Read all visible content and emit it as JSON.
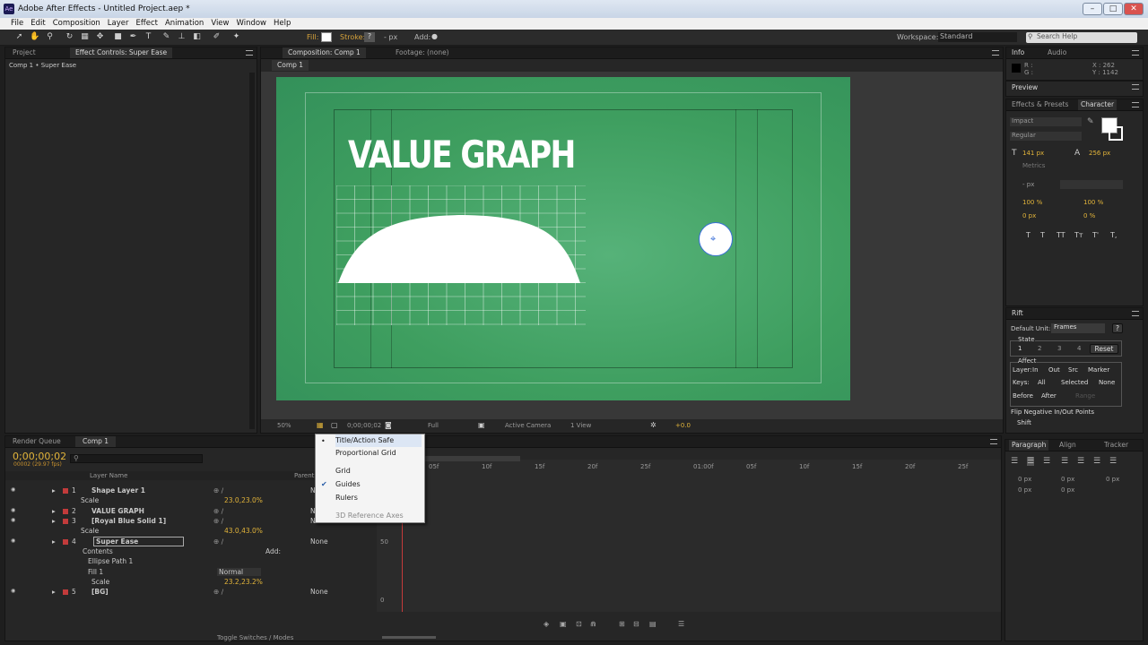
{
  "window": {
    "title": "Adobe After Effects - Untitled Project.aep *",
    "app_icon": "Ae",
    "min": "–",
    "max": "□",
    "close": "✕"
  },
  "menu": [
    "File",
    "Edit",
    "Composition",
    "Layer",
    "Effect",
    "Animation",
    "View",
    "Window",
    "Help"
  ],
  "toolbar": {
    "fill_label": "Fill:",
    "stroke_label": "Stroke:",
    "stroke_value": "?",
    "px_label": "- px",
    "add_label": "Add:",
    "workspace_label": "Workspace:",
    "workspace_value": "Standard",
    "search_placeholder": "Search Help"
  },
  "left_panel": {
    "tab_project": "Project",
    "tab_effect_controls": "Effect Controls: Super Ease",
    "subtitle": "Comp 1 • Super Ease"
  },
  "comp_panel": {
    "tab_comp": "Composition: Comp 1",
    "tab_footage": "Footage: (none)",
    "sub_tab": "Comp 1",
    "headline": "VALUE GRAPH"
  },
  "viewer_footer": {
    "zoom": "50%",
    "time": "0;00;00;02",
    "resolution": "Full",
    "camera": "Active Camera",
    "view": "1 View",
    "exposure": "+0.0"
  },
  "info_panel": {
    "tab_info": "Info",
    "tab_audio": "Audio",
    "r": "R :",
    "g": "G :",
    "x": "X : 262",
    "y": "Y : 1142"
  },
  "preview_tab": "Preview",
  "character_panel": {
    "tab_effects": "Effects & Presets",
    "tab_character": "Character",
    "font": "Impact",
    "style": "Regular",
    "size": "141 px",
    "leading": "256 px",
    "metrics": "Metrics",
    "tracking_unit": "- px",
    "vscale": "100 %",
    "hscale": "100 %",
    "baseline": "0 px",
    "tsume": "0 %",
    "text_styles": [
      "T",
      "T",
      "TT",
      "Tт",
      "T'",
      "T,"
    ]
  },
  "rift_panel": {
    "title": "Rift",
    "default_unit_label": "Default Unit:",
    "default_unit_value": "Frames",
    "help": "?",
    "state_label": "State",
    "states": [
      "1",
      "2",
      "3",
      "4"
    ],
    "reset": "Reset",
    "affect_label": "Affect",
    "layer_label": "Layer:",
    "layer_opts": [
      "In",
      "Out",
      "Src",
      "Marker"
    ],
    "keys_label": "Keys:",
    "keys_opts": [
      "All",
      "Selected",
      "None"
    ],
    "before_label": "Before",
    "after_label": "After",
    "range_label": "Range",
    "flip_label": "Flip Negative In/Out Points",
    "shift_label": "Shift"
  },
  "timeline": {
    "tab_render": "Render Queue",
    "tab_comp": "Comp 1",
    "timecode": "0;00;00;02",
    "timecode_sub": "00002 (29.97 fps)",
    "col_layer_name": "Layer Name",
    "col_parent": "Parent",
    "toggle_label": "Toggle Switches / Modes",
    "rows": [
      {
        "num": "1",
        "name": "Shape Layer 1",
        "color": "#c23b3b",
        "parent": "None"
      },
      {
        "num": "",
        "name": "Scale",
        "color": "",
        "parent": "",
        "value": "23.0,23.0%"
      },
      {
        "num": "2",
        "name": "VALUE GRAPH",
        "color": "#c23b3b",
        "parent": "None"
      },
      {
        "num": "3",
        "name": "[Royal Blue Solid 1]",
        "color": "#c23b3b",
        "parent": "None"
      },
      {
        "num": "",
        "name": "Scale",
        "color": "",
        "parent": "",
        "value": "43.0,43.0%"
      },
      {
        "num": "4",
        "name": "Super Ease",
        "color": "#c23b3b",
        "parent": "None"
      },
      {
        "num": "",
        "name": "Contents",
        "color": "",
        "parent": "",
        "add": "Add:"
      },
      {
        "num": "",
        "name": "Ellipse Path 1",
        "color": "",
        "parent": ""
      },
      {
        "num": "",
        "name": "Fill 1",
        "color": "",
        "parent": "",
        "mode": "Normal"
      },
      {
        "num": "",
        "name": "Scale",
        "color": "",
        "parent": "",
        "value": "23.2,23.2%"
      },
      {
        "num": "5",
        "name": "[BG]",
        "color": "#c23b3b",
        "parent": "None"
      }
    ],
    "ruler": [
      "05f",
      "10f",
      "15f",
      "20f",
      "25f",
      "01:00f",
      "05f",
      "10f",
      "15f",
      "20f",
      "25f"
    ],
    "graph_labels": [
      "50",
      "0"
    ]
  },
  "dropdown": {
    "items": [
      "Title/Action Safe",
      "Proportional Grid",
      "Grid",
      "Guides",
      "Rulers",
      "3D Reference Axes"
    ]
  },
  "right_bottom": {
    "tab_paragraph": "Paragraph",
    "tab_align": "Align",
    "tab_tracker": "Tracker",
    "indent1": "0 px",
    "indent2": "0 px",
    "indent3": "0 px",
    "space1": "0 px",
    "space2": "0 px"
  },
  "colors": {
    "comp_green": "#3e9e5f",
    "label_red": "#c23b3b",
    "label_blue": "#2a7fd4",
    "accent_yellow": "#e2b43a"
  }
}
